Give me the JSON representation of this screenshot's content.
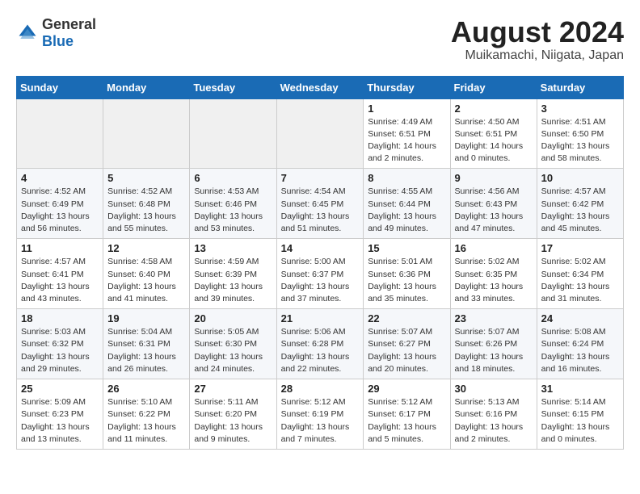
{
  "header": {
    "logo_general": "General",
    "logo_blue": "Blue",
    "title": "August 2024",
    "subtitle": "Muikamachi, Niigata, Japan"
  },
  "weekdays": [
    "Sunday",
    "Monday",
    "Tuesday",
    "Wednesday",
    "Thursday",
    "Friday",
    "Saturday"
  ],
  "weeks": [
    [
      {
        "day": "",
        "info": ""
      },
      {
        "day": "",
        "info": ""
      },
      {
        "day": "",
        "info": ""
      },
      {
        "day": "",
        "info": ""
      },
      {
        "day": "1",
        "info": "Sunrise: 4:49 AM\nSunset: 6:51 PM\nDaylight: 14 hours\nand 2 minutes."
      },
      {
        "day": "2",
        "info": "Sunrise: 4:50 AM\nSunset: 6:51 PM\nDaylight: 14 hours\nand 0 minutes."
      },
      {
        "day": "3",
        "info": "Sunrise: 4:51 AM\nSunset: 6:50 PM\nDaylight: 13 hours\nand 58 minutes."
      }
    ],
    [
      {
        "day": "4",
        "info": "Sunrise: 4:52 AM\nSunset: 6:49 PM\nDaylight: 13 hours\nand 56 minutes."
      },
      {
        "day": "5",
        "info": "Sunrise: 4:52 AM\nSunset: 6:48 PM\nDaylight: 13 hours\nand 55 minutes."
      },
      {
        "day": "6",
        "info": "Sunrise: 4:53 AM\nSunset: 6:46 PM\nDaylight: 13 hours\nand 53 minutes."
      },
      {
        "day": "7",
        "info": "Sunrise: 4:54 AM\nSunset: 6:45 PM\nDaylight: 13 hours\nand 51 minutes."
      },
      {
        "day": "8",
        "info": "Sunrise: 4:55 AM\nSunset: 6:44 PM\nDaylight: 13 hours\nand 49 minutes."
      },
      {
        "day": "9",
        "info": "Sunrise: 4:56 AM\nSunset: 6:43 PM\nDaylight: 13 hours\nand 47 minutes."
      },
      {
        "day": "10",
        "info": "Sunrise: 4:57 AM\nSunset: 6:42 PM\nDaylight: 13 hours\nand 45 minutes."
      }
    ],
    [
      {
        "day": "11",
        "info": "Sunrise: 4:57 AM\nSunset: 6:41 PM\nDaylight: 13 hours\nand 43 minutes."
      },
      {
        "day": "12",
        "info": "Sunrise: 4:58 AM\nSunset: 6:40 PM\nDaylight: 13 hours\nand 41 minutes."
      },
      {
        "day": "13",
        "info": "Sunrise: 4:59 AM\nSunset: 6:39 PM\nDaylight: 13 hours\nand 39 minutes."
      },
      {
        "day": "14",
        "info": "Sunrise: 5:00 AM\nSunset: 6:37 PM\nDaylight: 13 hours\nand 37 minutes."
      },
      {
        "day": "15",
        "info": "Sunrise: 5:01 AM\nSunset: 6:36 PM\nDaylight: 13 hours\nand 35 minutes."
      },
      {
        "day": "16",
        "info": "Sunrise: 5:02 AM\nSunset: 6:35 PM\nDaylight: 13 hours\nand 33 minutes."
      },
      {
        "day": "17",
        "info": "Sunrise: 5:02 AM\nSunset: 6:34 PM\nDaylight: 13 hours\nand 31 minutes."
      }
    ],
    [
      {
        "day": "18",
        "info": "Sunrise: 5:03 AM\nSunset: 6:32 PM\nDaylight: 13 hours\nand 29 minutes."
      },
      {
        "day": "19",
        "info": "Sunrise: 5:04 AM\nSunset: 6:31 PM\nDaylight: 13 hours\nand 26 minutes."
      },
      {
        "day": "20",
        "info": "Sunrise: 5:05 AM\nSunset: 6:30 PM\nDaylight: 13 hours\nand 24 minutes."
      },
      {
        "day": "21",
        "info": "Sunrise: 5:06 AM\nSunset: 6:28 PM\nDaylight: 13 hours\nand 22 minutes."
      },
      {
        "day": "22",
        "info": "Sunrise: 5:07 AM\nSunset: 6:27 PM\nDaylight: 13 hours\nand 20 minutes."
      },
      {
        "day": "23",
        "info": "Sunrise: 5:07 AM\nSunset: 6:26 PM\nDaylight: 13 hours\nand 18 minutes."
      },
      {
        "day": "24",
        "info": "Sunrise: 5:08 AM\nSunset: 6:24 PM\nDaylight: 13 hours\nand 16 minutes."
      }
    ],
    [
      {
        "day": "25",
        "info": "Sunrise: 5:09 AM\nSunset: 6:23 PM\nDaylight: 13 hours\nand 13 minutes."
      },
      {
        "day": "26",
        "info": "Sunrise: 5:10 AM\nSunset: 6:22 PM\nDaylight: 13 hours\nand 11 minutes."
      },
      {
        "day": "27",
        "info": "Sunrise: 5:11 AM\nSunset: 6:20 PM\nDaylight: 13 hours\nand 9 minutes."
      },
      {
        "day": "28",
        "info": "Sunrise: 5:12 AM\nSunset: 6:19 PM\nDaylight: 13 hours\nand 7 minutes."
      },
      {
        "day": "29",
        "info": "Sunrise: 5:12 AM\nSunset: 6:17 PM\nDaylight: 13 hours\nand 5 minutes."
      },
      {
        "day": "30",
        "info": "Sunrise: 5:13 AM\nSunset: 6:16 PM\nDaylight: 13 hours\nand 2 minutes."
      },
      {
        "day": "31",
        "info": "Sunrise: 5:14 AM\nSunset: 6:15 PM\nDaylight: 13 hours\nand 0 minutes."
      }
    ]
  ]
}
